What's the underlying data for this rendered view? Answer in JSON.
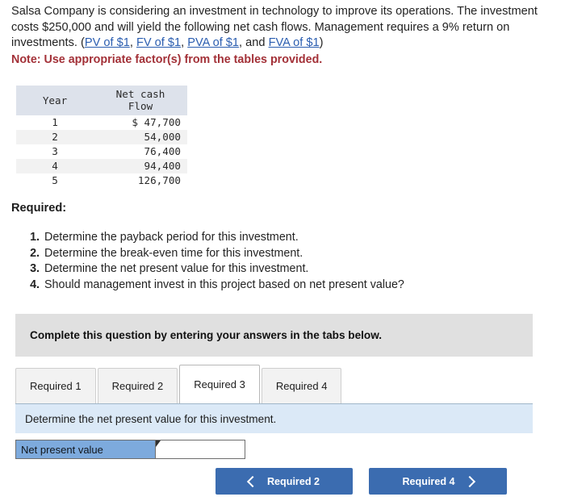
{
  "problem": {
    "sentence1": "Salsa Company is considering an investment in technology to improve its operations. The investment costs $250,000 and will yield the following net cash flows. Management requires a 9% return on investments. (",
    "links": [
      {
        "label": "PV of $1",
        "sep": ", "
      },
      {
        "label": "FV of $1",
        "sep": ", "
      },
      {
        "label": "PVA of $1",
        "sep": ", and "
      },
      {
        "label": "FVA of $1",
        "sep": ")"
      }
    ],
    "note": "Note: Use appropriate factor(s) from the tables provided."
  },
  "cash_flow_table": {
    "headers": [
      "Year",
      "Net cash Flow"
    ],
    "header_year": "Year",
    "header_flow_line1": "Net cash",
    "header_flow_line2": "Flow",
    "rows": [
      {
        "year": "1",
        "amount": "$ 47,700"
      },
      {
        "year": "2",
        "amount": "54,000"
      },
      {
        "year": "3",
        "amount": "76,400"
      },
      {
        "year": "4",
        "amount": "94,400"
      },
      {
        "year": "5",
        "amount": "126,700"
      }
    ]
  },
  "required": {
    "heading": "Required:",
    "items": [
      {
        "num": "1.",
        "text": "Determine the payback period for this investment."
      },
      {
        "num": "2.",
        "text": "Determine the break-even time for this investment."
      },
      {
        "num": "3.",
        "text": "Determine the net present value for this investment."
      },
      {
        "num": "4.",
        "text": "Should management invest in this project based on net present value?"
      }
    ]
  },
  "banner": {
    "text": "Complete this question by entering your answers in the tabs below."
  },
  "tabs": [
    {
      "label": "Required 1",
      "active": false
    },
    {
      "label": "Required 2",
      "active": false
    },
    {
      "label": "Required 3",
      "active": true
    },
    {
      "label": "Required 4",
      "active": false
    }
  ],
  "question_panel": {
    "text": "Determine the net present value for this investment."
  },
  "answer": {
    "label": "Net present value",
    "value": "",
    "placeholder": ""
  },
  "navigation": {
    "prev_label": "Required 2",
    "next_label": "Required 4"
  },
  "colors": {
    "link": "#2a5db0",
    "note_red": "#a33138",
    "banner_gray": "#e0e0e0",
    "panel_blue": "#dbe9f7",
    "answer_label_blue": "#7daadd",
    "button_blue": "#3b6cb0",
    "table_header": "#dde2eb",
    "table_stripe": "#f2f2f2"
  }
}
